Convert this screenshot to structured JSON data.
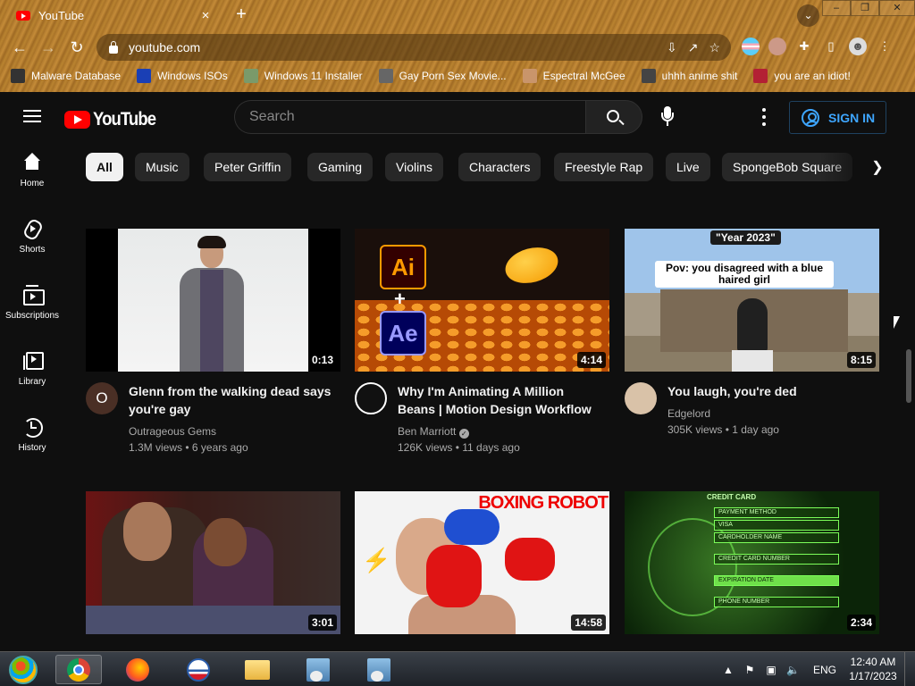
{
  "browser": {
    "tab_title": "YouTube",
    "tab_close": "×",
    "new_tab": "+",
    "url": "youtube.com",
    "bookmarks": [
      {
        "label": "Malware Database",
        "icon": "skull-icon",
        "color": "#333333"
      },
      {
        "label": "Windows ISOs",
        "icon": "x-logo-icon",
        "color": "#1a3fb5"
      },
      {
        "label": "Windows 11 Installer",
        "icon": "image-icon",
        "color": "#7a9a6a"
      },
      {
        "label": "Gay Porn Sex Movie...",
        "icon": "cube-icon",
        "color": "#666666"
      },
      {
        "label": "Espectral McGee",
        "icon": "face-icon",
        "color": "#c9956b"
      },
      {
        "label": "uhhh anime shit",
        "icon": "anime-icon",
        "color": "#444444"
      },
      {
        "label": "you are an idiot!",
        "icon": "uk-flag-icon",
        "color": "#b32034"
      }
    ]
  },
  "youtube": {
    "logo_text": "YouTube",
    "search_placeholder": "Search",
    "sign_in_label": "SIGN IN",
    "accent_color": "#ff0000",
    "sidebar": [
      {
        "label": "Home",
        "icon": "home-icon"
      },
      {
        "label": "Shorts",
        "icon": "shorts-icon"
      },
      {
        "label": "Subscriptions",
        "icon": "subscriptions-icon"
      },
      {
        "label": "Library",
        "icon": "library-icon"
      },
      {
        "label": "History",
        "icon": "history-icon"
      }
    ],
    "chips": [
      "All",
      "Music",
      "Peter Griffin",
      "Gaming",
      "Violins",
      "Characters",
      "Freestyle Rap",
      "Live",
      "SpongeBob Square"
    ],
    "active_chip": "All",
    "videos": [
      {
        "title": "Glenn from the walking dead says you're gay",
        "channel": "Outrageous Gems",
        "views": "1.3M views",
        "age": "6 years ago",
        "duration": "0:13",
        "avatar_letter": "O",
        "verified": false
      },
      {
        "title": "Why I'm Animating A Million Beans | Motion Design Workflow",
        "channel": "Ben Marriott",
        "views": "126K views",
        "age": "11 days ago",
        "duration": "4:14",
        "avatar_letter": "",
        "verified": true
      },
      {
        "title": "You laugh, you're ded",
        "channel": "Edgelord",
        "views": "305K views",
        "age": "1 day ago",
        "duration": "8:15",
        "avatar_letter": "",
        "verified": false
      },
      {
        "title": "",
        "channel": "",
        "views": "",
        "age": "",
        "duration": "3:01",
        "avatar_letter": "",
        "verified": false
      },
      {
        "title": "",
        "channel": "",
        "views": "",
        "age": "",
        "duration": "14:58",
        "avatar_letter": "",
        "verified": false
      },
      {
        "title": "",
        "channel": "",
        "views": "",
        "age": "",
        "duration": "2:34",
        "avatar_letter": "",
        "verified": false
      }
    ],
    "thumb_text": {
      "ai": "Ai",
      "plus": "+",
      "ae": "Ae",
      "year_caption": "\"Year 2023\"",
      "pov_caption": "Pov: you disagreed with a blue haired girl",
      "boxing_title": "BOXING ROBOT",
      "card_header": "CREDIT CARD",
      "card_rows": [
        "PAYMENT METHOD",
        "VISA",
        "CARDHOLDER NAME",
        "CREDIT CARD NUMBER",
        "EXPIRATION DATE",
        "PHONE NUMBER"
      ]
    }
  },
  "taskbar": {
    "language": "ENG",
    "time": "12:40 AM",
    "date": "1/17/2023"
  }
}
